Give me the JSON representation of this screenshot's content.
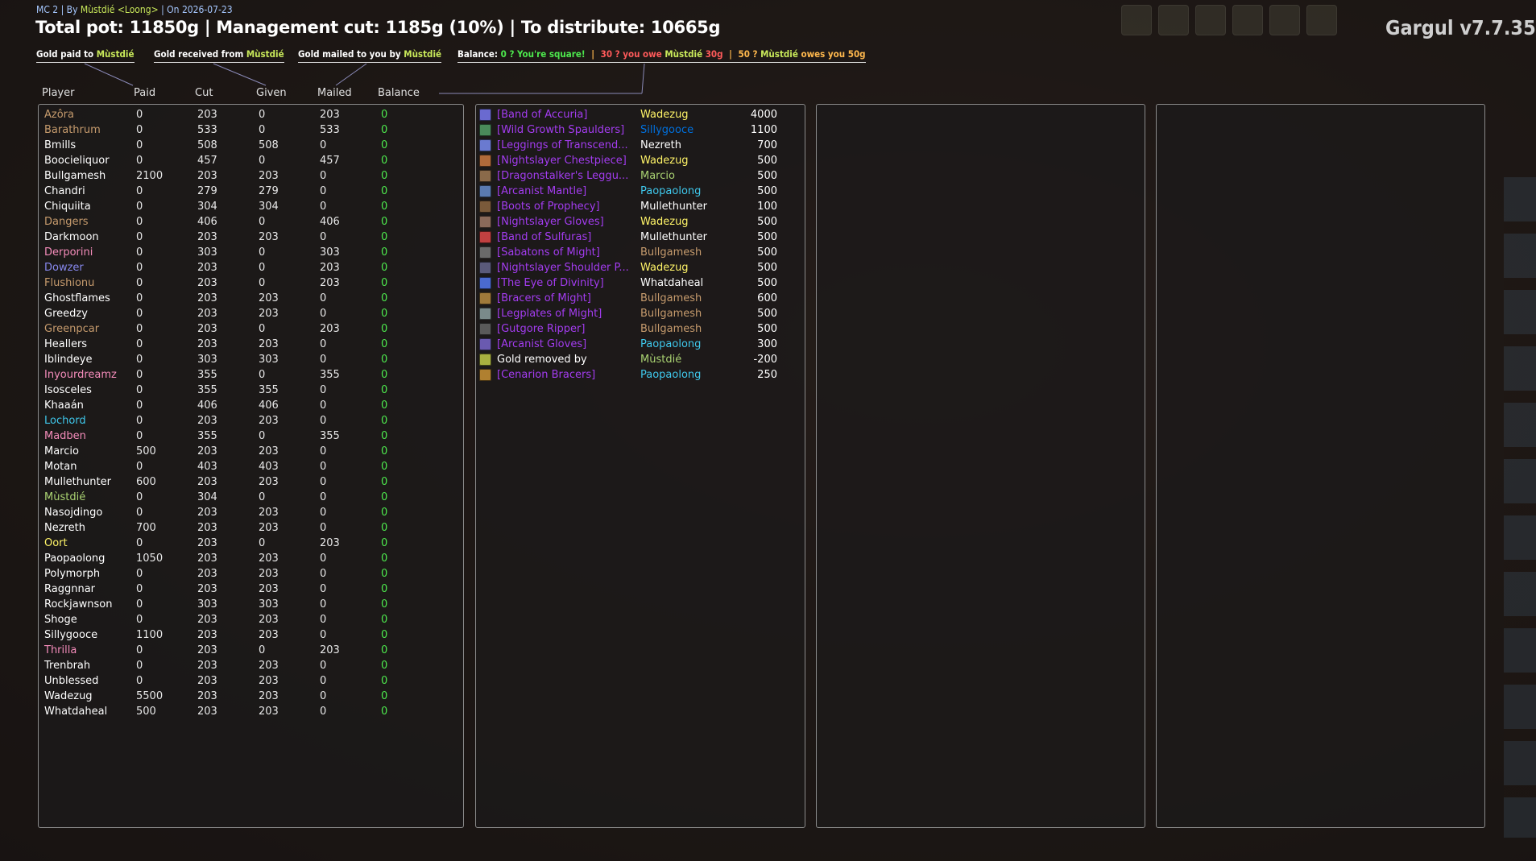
{
  "header": {
    "raid": "MC 2",
    "by_label": "By",
    "author": "Mùstdié",
    "guild": "<Loong>",
    "on_label": "On",
    "date": "2026-07-23",
    "summary": "Total pot: 11850g | Management cut: 1185g (10%) | To distribute: 10665g",
    "version": "Gargul v7.7.35"
  },
  "legend": {
    "paid_prefix": "Gold paid to",
    "received_prefix": "Gold received from",
    "mailed_prefix": "Gold mailed to you by",
    "name": "Mùstdié",
    "balance_label": "Balance:",
    "square": "0 ? You're square!",
    "owe_prefix": "30 ? you owe",
    "owe_amount": "30g",
    "owed_prefix": "50 ?",
    "owed_suffix": "owes you 50g",
    "sep": "|"
  },
  "columns": {
    "player": "Player",
    "paid": "Paid",
    "cut": "Cut",
    "given": "Given",
    "mailed": "Mailed",
    "balance": "Balance"
  },
  "players": [
    {
      "name": "Azôra",
      "paid": "0",
      "cut": "203",
      "given": "0",
      "mailed": "203",
      "balance": "0",
      "color": "#c69b6d"
    },
    {
      "name": "Barathrum",
      "paid": "0",
      "cut": "533",
      "given": "0",
      "mailed": "533",
      "balance": "0",
      "color": "#c69b6d"
    },
    {
      "name": "Bmills",
      "paid": "0",
      "cut": "508",
      "given": "508",
      "mailed": "0",
      "balance": "0",
      "color": "#ffffff"
    },
    {
      "name": "Boocieliquor",
      "paid": "0",
      "cut": "457",
      "given": "0",
      "mailed": "457",
      "balance": "0",
      "color": "#ffffff"
    },
    {
      "name": "Bullgamesh",
      "paid": "2100",
      "cut": "203",
      "given": "203",
      "mailed": "0",
      "balance": "0",
      "color": "#ffffff"
    },
    {
      "name": "Chandri",
      "paid": "0",
      "cut": "279",
      "given": "279",
      "mailed": "0",
      "balance": "0",
      "color": "#ffffff"
    },
    {
      "name": "Chiquiita",
      "paid": "0",
      "cut": "304",
      "given": "304",
      "mailed": "0",
      "balance": "0",
      "color": "#ffffff"
    },
    {
      "name": "Dangers",
      "paid": "0",
      "cut": "406",
      "given": "0",
      "mailed": "406",
      "balance": "0",
      "color": "#c69b6d"
    },
    {
      "name": "Darkmoon",
      "paid": "0",
      "cut": "203",
      "given": "203",
      "mailed": "0",
      "balance": "0",
      "color": "#ffffff"
    },
    {
      "name": "Derporini",
      "paid": "0",
      "cut": "303",
      "given": "0",
      "mailed": "303",
      "balance": "0",
      "color": "#f48cba"
    },
    {
      "name": "Dowzer",
      "paid": "0",
      "cut": "203",
      "given": "0",
      "mailed": "203",
      "balance": "0",
      "color": "#8788ee"
    },
    {
      "name": "Flushionu",
      "paid": "0",
      "cut": "203",
      "given": "0",
      "mailed": "203",
      "balance": "0",
      "color": "#c69b6d"
    },
    {
      "name": "Ghostflames",
      "paid": "0",
      "cut": "203",
      "given": "203",
      "mailed": "0",
      "balance": "0",
      "color": "#ffffff"
    },
    {
      "name": "Greedzy",
      "paid": "0",
      "cut": "203",
      "given": "203",
      "mailed": "0",
      "balance": "0",
      "color": "#ffffff"
    },
    {
      "name": "Greenpcar",
      "paid": "0",
      "cut": "203",
      "given": "0",
      "mailed": "203",
      "balance": "0",
      "color": "#c69b6d"
    },
    {
      "name": "Heallers",
      "paid": "0",
      "cut": "203",
      "given": "203",
      "mailed": "0",
      "balance": "0",
      "color": "#ffffff"
    },
    {
      "name": "Iblindeye",
      "paid": "0",
      "cut": "303",
      "given": "303",
      "mailed": "0",
      "balance": "0",
      "color": "#ffffff"
    },
    {
      "name": "Inyourdreamz",
      "paid": "0",
      "cut": "355",
      "given": "0",
      "mailed": "355",
      "balance": "0",
      "color": "#f48cba"
    },
    {
      "name": "Isosceles",
      "paid": "0",
      "cut": "355",
      "given": "355",
      "mailed": "0",
      "balance": "0",
      "color": "#ffffff"
    },
    {
      "name": "Khaaán",
      "paid": "0",
      "cut": "406",
      "given": "406",
      "mailed": "0",
      "balance": "0",
      "color": "#ffffff"
    },
    {
      "name": "Lochord",
      "paid": "0",
      "cut": "203",
      "given": "203",
      "mailed": "0",
      "balance": "0",
      "color": "#3fc7eb"
    },
    {
      "name": "Madben",
      "paid": "0",
      "cut": "355",
      "given": "0",
      "mailed": "355",
      "balance": "0",
      "color": "#f48cba"
    },
    {
      "name": "Marcio",
      "paid": "500",
      "cut": "203",
      "given": "203",
      "mailed": "0",
      "balance": "0",
      "color": "#ffffff"
    },
    {
      "name": "Motan",
      "paid": "0",
      "cut": "403",
      "given": "403",
      "mailed": "0",
      "balance": "0",
      "color": "#ffffff"
    },
    {
      "name": "Mullethunter",
      "paid": "600",
      "cut": "203",
      "given": "203",
      "mailed": "0",
      "balance": "0",
      "color": "#ffffff"
    },
    {
      "name": "Mùstdié",
      "paid": "0",
      "cut": "304",
      "given": "0",
      "mailed": "0",
      "balance": "0",
      "color": "#aad372"
    },
    {
      "name": "Nasojdingo",
      "paid": "0",
      "cut": "203",
      "given": "203",
      "mailed": "0",
      "balance": "0",
      "color": "#ffffff"
    },
    {
      "name": "Nezreth",
      "paid": "700",
      "cut": "203",
      "given": "203",
      "mailed": "0",
      "balance": "0",
      "color": "#ffffff"
    },
    {
      "name": "Oort",
      "paid": "0",
      "cut": "203",
      "given": "0",
      "mailed": "203",
      "balance": "0",
      "color": "#fff468"
    },
    {
      "name": "Paopaolong",
      "paid": "1050",
      "cut": "203",
      "given": "203",
      "mailed": "0",
      "balance": "0",
      "color": "#ffffff"
    },
    {
      "name": "Polymorph",
      "paid": "0",
      "cut": "203",
      "given": "203",
      "mailed": "0",
      "balance": "0",
      "color": "#ffffff"
    },
    {
      "name": "Raggnnar",
      "paid": "0",
      "cut": "203",
      "given": "203",
      "mailed": "0",
      "balance": "0",
      "color": "#ffffff"
    },
    {
      "name": "Rockjawnson",
      "paid": "0",
      "cut": "303",
      "given": "303",
      "mailed": "0",
      "balance": "0",
      "color": "#ffffff"
    },
    {
      "name": "Shoge",
      "paid": "0",
      "cut": "203",
      "given": "203",
      "mailed": "0",
      "balance": "0",
      "color": "#ffffff"
    },
    {
      "name": "Sillygooce",
      "paid": "1100",
      "cut": "203",
      "given": "203",
      "mailed": "0",
      "balance": "0",
      "color": "#ffffff"
    },
    {
      "name": "Thrilla",
      "paid": "0",
      "cut": "203",
      "given": "0",
      "mailed": "203",
      "balance": "0",
      "color": "#f48cba"
    },
    {
      "name": "Trenbrah",
      "paid": "0",
      "cut": "203",
      "given": "203",
      "mailed": "0",
      "balance": "0",
      "color": "#ffffff"
    },
    {
      "name": "Unblessed",
      "paid": "0",
      "cut": "203",
      "given": "203",
      "mailed": "0",
      "balance": "0",
      "color": "#ffffff"
    },
    {
      "name": "Wadezug",
      "paid": "5500",
      "cut": "203",
      "given": "203",
      "mailed": "0",
      "balance": "0",
      "color": "#ffffff"
    },
    {
      "name": "Whatdaheal",
      "paid": "500",
      "cut": "203",
      "given": "203",
      "mailed": "0",
      "balance": "0",
      "color": "#ffffff"
    }
  ],
  "loot": [
    {
      "item": "[Band of Accuria]",
      "winner": "Wadezug",
      "amount": "4000",
      "winner_color": "#fff468",
      "icon": "ring-icon",
      "icon_color": "#6a6ad0"
    },
    {
      "item": "[Wild Growth Spaulders]",
      "winner": "Sillygooce",
      "amount": "1100",
      "winner_color": "#0070dd",
      "icon": "shoulder-icon",
      "icon_color": "#4a8a5a"
    },
    {
      "item": "[Leggings of Transcend...",
      "winner": "Nezreth",
      "amount": "700",
      "winner_color": "#ffffff",
      "icon": "leggings-icon",
      "icon_color": "#6a7ad0"
    },
    {
      "item": "[Nightslayer Chestpiece]",
      "winner": "Wadezug",
      "amount": "500",
      "winner_color": "#fff468",
      "icon": "chest-icon",
      "icon_color": "#b06a3a"
    },
    {
      "item": "[Dragonstalker's Leggu...",
      "winner": "Marcio",
      "amount": "500",
      "winner_color": "#aad372",
      "icon": "leggings-icon",
      "icon_color": "#8a6a4a"
    },
    {
      "item": "[Arcanist Mantle]",
      "winner": "Paopaolong",
      "amount": "500",
      "winner_color": "#3fc7eb",
      "icon": "shoulder-icon",
      "icon_color": "#5a7ab0"
    },
    {
      "item": "[Boots of Prophecy]",
      "winner": "Mullethunter",
      "amount": "100",
      "winner_color": "#ffffff",
      "icon": "boots-icon",
      "icon_color": "#7a5a3a"
    },
    {
      "item": "[Nightslayer Gloves]",
      "winner": "Wadezug",
      "amount": "500",
      "winner_color": "#fff468",
      "icon": "gloves-icon",
      "icon_color": "#8a6a5a"
    },
    {
      "item": "[Band of Sulfuras]",
      "winner": "Mullethunter",
      "amount": "500",
      "winner_color": "#ffffff",
      "icon": "ring-icon",
      "icon_color": "#c04040"
    },
    {
      "item": "[Sabatons of Might]",
      "winner": "Bullgamesh",
      "amount": "500",
      "winner_color": "#c69b6d",
      "icon": "boots-icon",
      "icon_color": "#6a6a6a"
    },
    {
      "item": "[Nightslayer Shoulder P...",
      "winner": "Wadezug",
      "amount": "500",
      "winner_color": "#fff468",
      "icon": "shoulder-icon",
      "icon_color": "#5a5a7a"
    },
    {
      "item": "[The Eye of Divinity]",
      "winner": "Whatdaheal",
      "amount": "500",
      "winner_color": "#ffffff",
      "icon": "eye-icon",
      "icon_color": "#4a6ad0"
    },
    {
      "item": "[Bracers of Might]",
      "winner": "Bullgamesh",
      "amount": "600",
      "winner_color": "#c69b6d",
      "icon": "bracers-icon",
      "icon_color": "#a07a3a"
    },
    {
      "item": "[Legplates of Might]",
      "winner": "Bullgamesh",
      "amount": "500",
      "winner_color": "#c69b6d",
      "icon": "leggings-icon",
      "icon_color": "#7a8a8a"
    },
    {
      "item": "[Gutgore Ripper]",
      "winner": "Bullgamesh",
      "amount": "500",
      "winner_color": "#c69b6d",
      "icon": "dagger-icon",
      "icon_color": "#5a5a5a"
    },
    {
      "item": "[Arcanist Gloves]",
      "winner": "Paopaolong",
      "amount": "300",
      "winner_color": "#3fc7eb",
      "icon": "gloves-icon",
      "icon_color": "#6a5ab0"
    },
    {
      "item": "Gold removed by",
      "winner": "Mùstdié",
      "amount": "-200",
      "winner_color": "#aad372",
      "icon": "gold-coin-icon",
      "icon_color": "#a8b040",
      "item_color": "#ffffff"
    },
    {
      "item": "[Cenarion Bracers]",
      "winner": "Paopaolong",
      "amount": "250",
      "winner_color": "#3fc7eb",
      "icon": "bracers-icon",
      "icon_color": "#b08030"
    }
  ],
  "colors": {
    "balance_zero": "#4de84d",
    "epic_item": "#a33cf0",
    "panel_border": "#8a8a8a"
  }
}
